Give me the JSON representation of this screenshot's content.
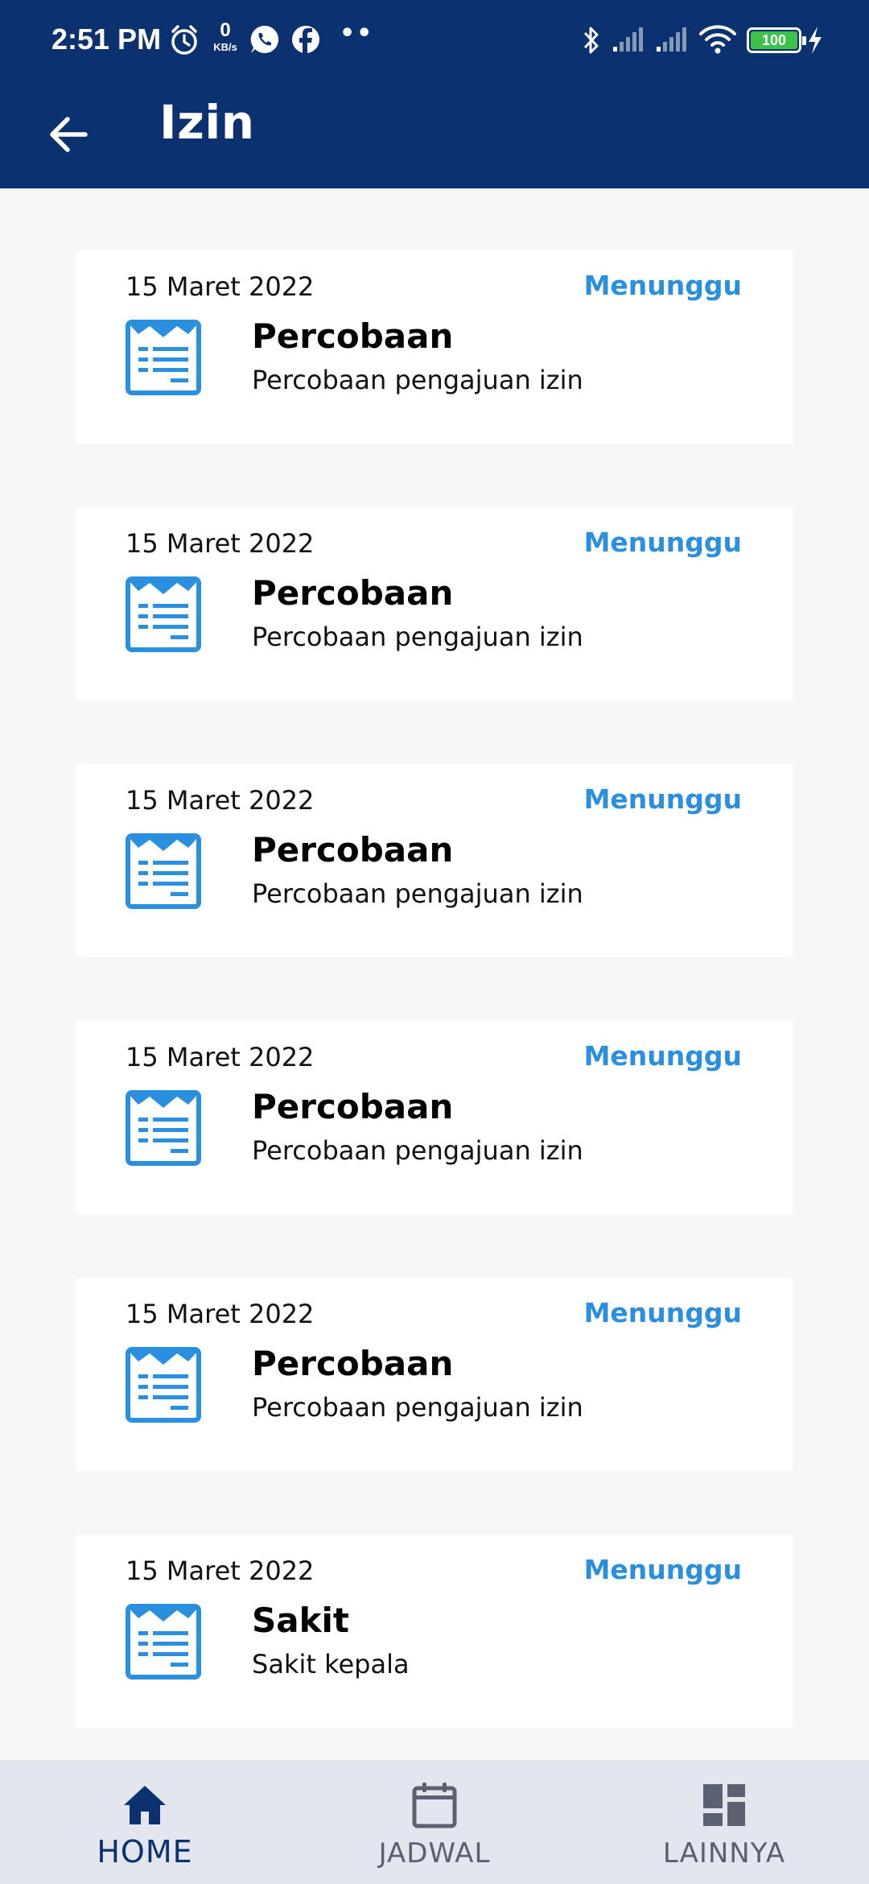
{
  "status_bar": {
    "time": "2:51 PM",
    "net_speed_value": "0",
    "net_speed_unit": "KB/s",
    "overflow": "••",
    "battery": "100",
    "icons": [
      "alarm-icon",
      "whatsapp-icon",
      "facebook-icon",
      "bluetooth-icon",
      "signal-icon",
      "signal-icon",
      "wifi-icon",
      "battery-icon",
      "charging-icon"
    ]
  },
  "app_bar": {
    "title": "Izin",
    "back_icon": "arrow-left-icon"
  },
  "items": [
    {
      "date": "15 Maret 2022",
      "status": "Menunggu",
      "title": "Percobaan",
      "description": "Percobaan pengajuan izin"
    },
    {
      "date": "15 Maret 2022",
      "status": "Menunggu",
      "title": "Percobaan",
      "description": "Percobaan pengajuan izin"
    },
    {
      "date": "15 Maret 2022",
      "status": "Menunggu",
      "title": "Percobaan",
      "description": "Percobaan pengajuan izin"
    },
    {
      "date": "15 Maret 2022",
      "status": "Menunggu",
      "title": "Percobaan",
      "description": "Percobaan pengajuan izin"
    },
    {
      "date": "15 Maret 2022",
      "status": "Menunggu",
      "title": "Percobaan",
      "description": "Percobaan pengajuan izin"
    },
    {
      "date": "15 Maret 2022",
      "status": "Menunggu",
      "title": "Sakit",
      "description": "Sakit kepala"
    }
  ],
  "bottom_nav": [
    {
      "label": "HOME",
      "icon": "home-icon",
      "active": true
    },
    {
      "label": "JADWAL",
      "icon": "calendar-icon",
      "active": false
    },
    {
      "label": "LAINNYA",
      "icon": "dashboard-icon",
      "active": false
    }
  ],
  "colors": {
    "primary": "#0b3170",
    "accent": "#2b8fe0",
    "background": "#f6f7f9",
    "nav_background": "#e3e6ef",
    "nav_inactive": "#5b6170"
  }
}
